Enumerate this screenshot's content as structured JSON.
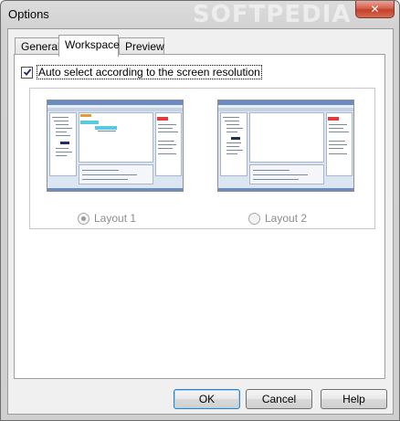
{
  "window": {
    "title": "Options",
    "watermark": "SOFTPEDIA",
    "close_glyph": "✕"
  },
  "tabs": [
    {
      "label": "General",
      "active": false
    },
    {
      "label": "Workspace",
      "active": true
    },
    {
      "label": "Preview",
      "active": false
    }
  ],
  "workspace": {
    "auto_select_label": "Auto select according to the screen resolution",
    "auto_select_checked": true,
    "layouts": [
      {
        "label": "Layout 1",
        "selected": true,
        "enabled": false
      },
      {
        "label": "Layout 2",
        "selected": false,
        "enabled": false
      }
    ]
  },
  "buttons": {
    "ok": "OK",
    "cancel": "Cancel",
    "help": "Help"
  },
  "colors": {
    "default_button_border": "#3c7fb1",
    "close_button": "#c5402a",
    "disabled_text": "#8d8d8d"
  }
}
